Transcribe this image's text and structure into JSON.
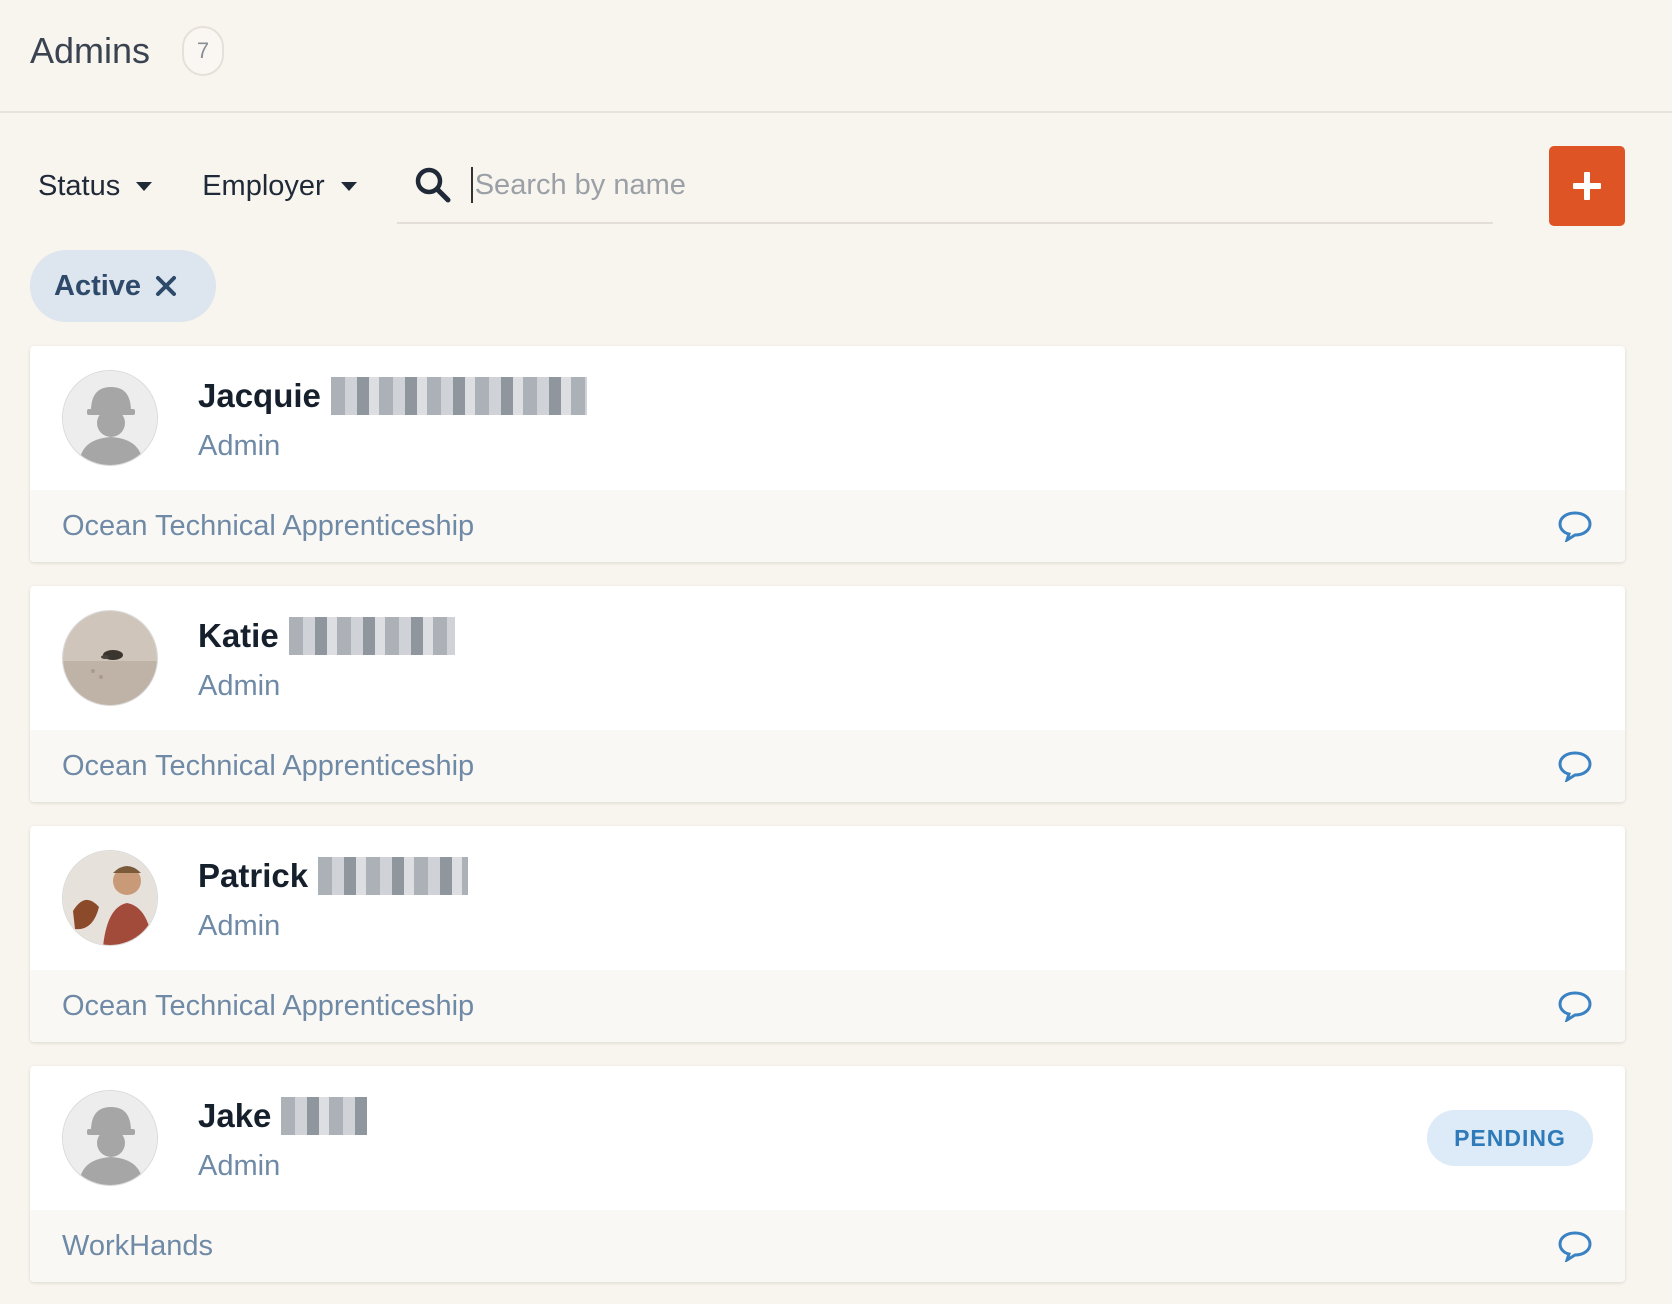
{
  "header": {
    "title": "Admins",
    "count": "7"
  },
  "filters": {
    "status_label": "Status",
    "employer_label": "Employer"
  },
  "search": {
    "placeholder": "Search by name",
    "value": ""
  },
  "active_chip": {
    "label": "Active"
  },
  "colors": {
    "accent": "#de5424",
    "chip_bg": "#dde5ee",
    "pending_bg": "#dcebf7"
  },
  "admins": [
    {
      "first_name": "Jacquie",
      "role": "Admin",
      "employer": "Ocean Technical Apprenticeship",
      "avatar": "placeholder-avatar",
      "status": ""
    },
    {
      "first_name": "Katie",
      "role": "Admin",
      "employer": "Ocean Technical Apprenticeship",
      "avatar": "photo-avatar",
      "status": ""
    },
    {
      "first_name": "Patrick",
      "role": "Admin",
      "employer": "Ocean Technical Apprenticeship",
      "avatar": "photo-avatar",
      "status": ""
    },
    {
      "first_name": "Jake",
      "role": "Admin",
      "employer": "WorkHands",
      "avatar": "placeholder-avatar",
      "status": "PENDING"
    }
  ]
}
